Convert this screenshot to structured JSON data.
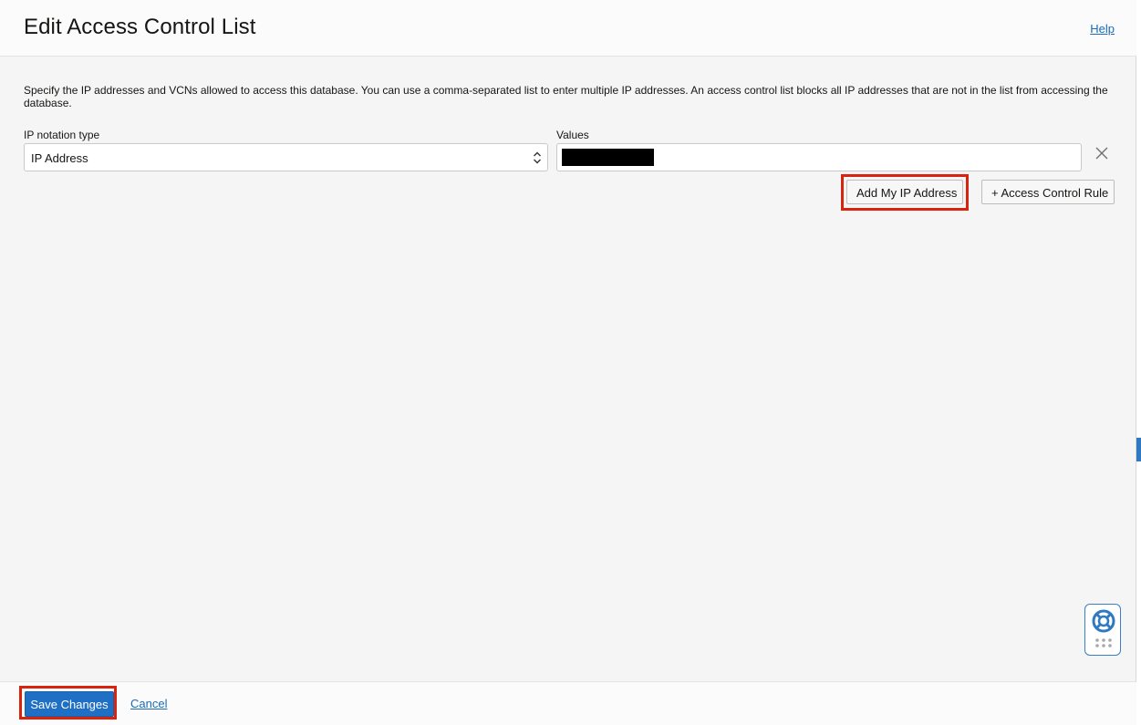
{
  "dialog": {
    "title": "Edit Access Control List",
    "help_label": "Help"
  },
  "description": "Specify the IP addresses and VCNs allowed to access this database. You can use a comma-separated list to enter multiple IP addresses. An access control list blocks all IP addresses that are not in the list from accessing the database.",
  "rule": {
    "notation_label": "IP notation type",
    "notation_value": "IP Address",
    "values_label": "Values"
  },
  "actions": {
    "add_my_ip_label": "Add My IP Address",
    "add_rule_label": "+ Access Control Rule"
  },
  "footer": {
    "save_label": "Save Changes",
    "cancel_label": "Cancel"
  },
  "colors": {
    "accent": "#1f6fc5",
    "link": "#1a6cba",
    "highlight": "#d9230f"
  },
  "icons": {
    "close": "close-icon",
    "select_arrows": "chevron-up-down-icon",
    "help_widget": "lifebuoy-icon",
    "grid": "grid-dots-icon"
  }
}
